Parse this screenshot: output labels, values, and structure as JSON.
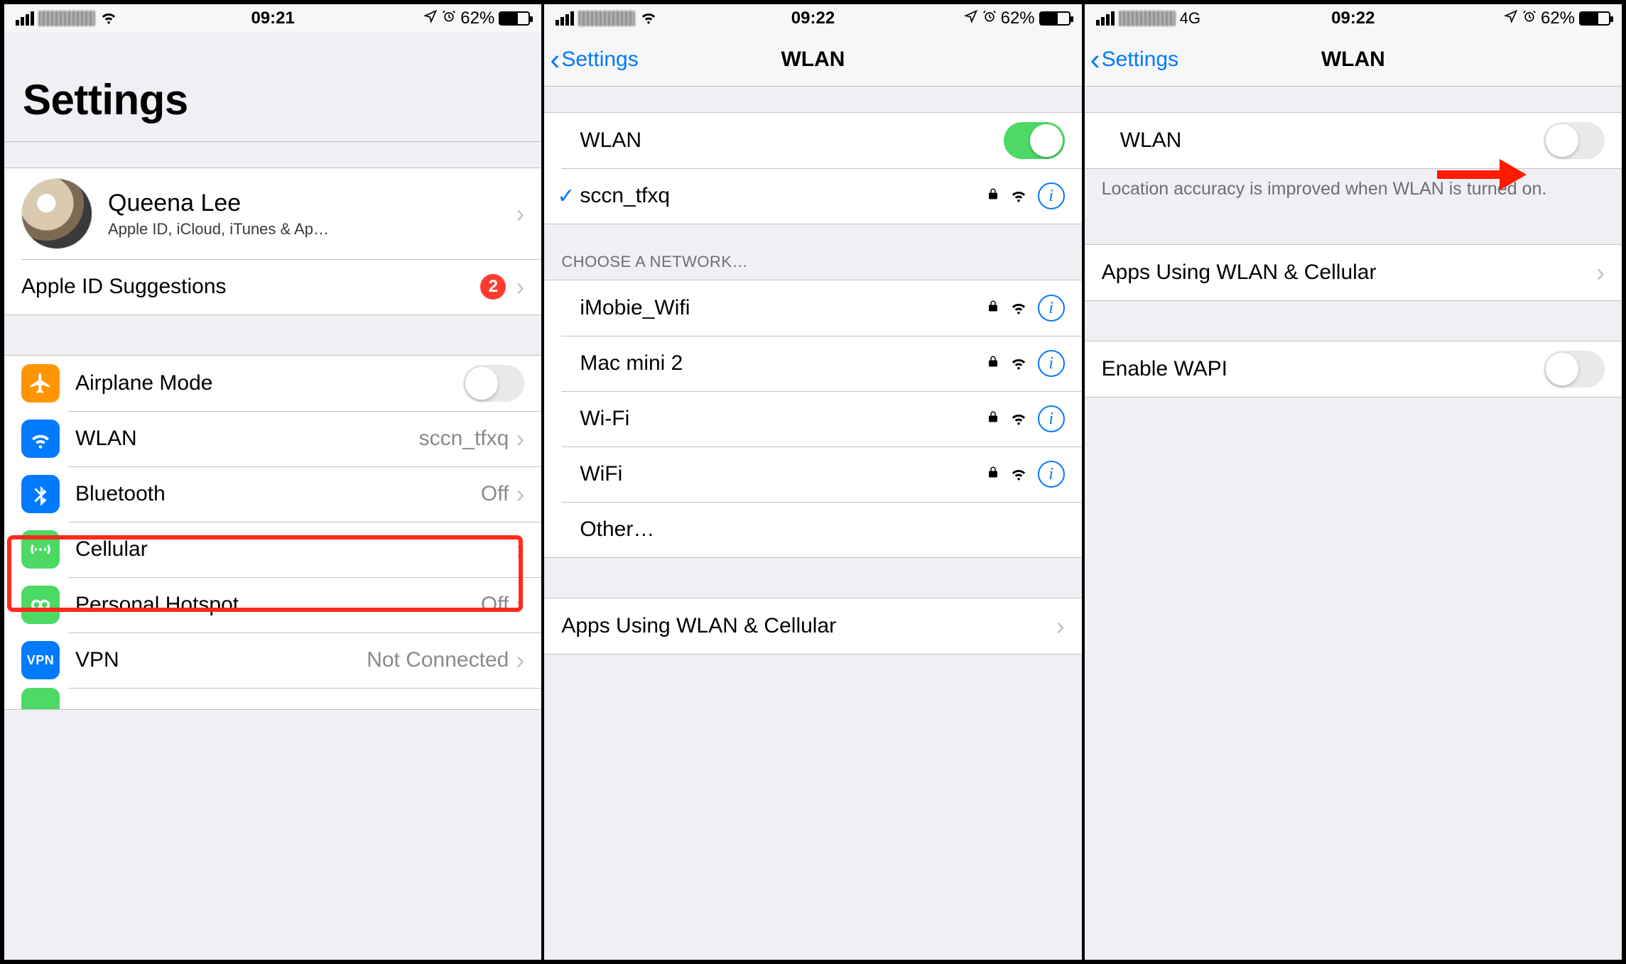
{
  "status": {
    "time1": "09:21",
    "time2": "09:22",
    "time3": "09:22",
    "battery": "62%",
    "net3_label": "4G"
  },
  "nav": {
    "back": "Settings",
    "title": "WLAN"
  },
  "screen1": {
    "title": "Settings",
    "profile_name": "Queena Lee",
    "profile_sub": "Apple ID, iCloud, iTunes & App St…",
    "apple_id_sugg": "Apple ID Suggestions",
    "apple_id_badge": "2",
    "rows": {
      "airplane": "Airplane Mode",
      "wlan": "WLAN",
      "wlan_val": "sccn_tfxq",
      "bt": "Bluetooth",
      "bt_val": "Off",
      "cell": "Cellular",
      "hotspot": "Personal Hotspot",
      "hotspot_val": "Off",
      "vpn": "VPN",
      "vpn_val": "Not Connected"
    }
  },
  "screen2": {
    "wlan_label": "WLAN",
    "connected": "sccn_tfxq",
    "choose_header": "CHOOSE A NETWORK…",
    "networks": [
      "iMobie_Wifi",
      "Mac mini 2",
      "Wi-Fi",
      "WiFi"
    ],
    "other": "Other…",
    "apps_row": "Apps Using WLAN & Cellular"
  },
  "screen3": {
    "wlan_label": "WLAN",
    "footer": "Location accuracy is improved when WLAN is turned on.",
    "apps_row": "Apps Using WLAN & Cellular",
    "wapi": "Enable WAPI"
  }
}
